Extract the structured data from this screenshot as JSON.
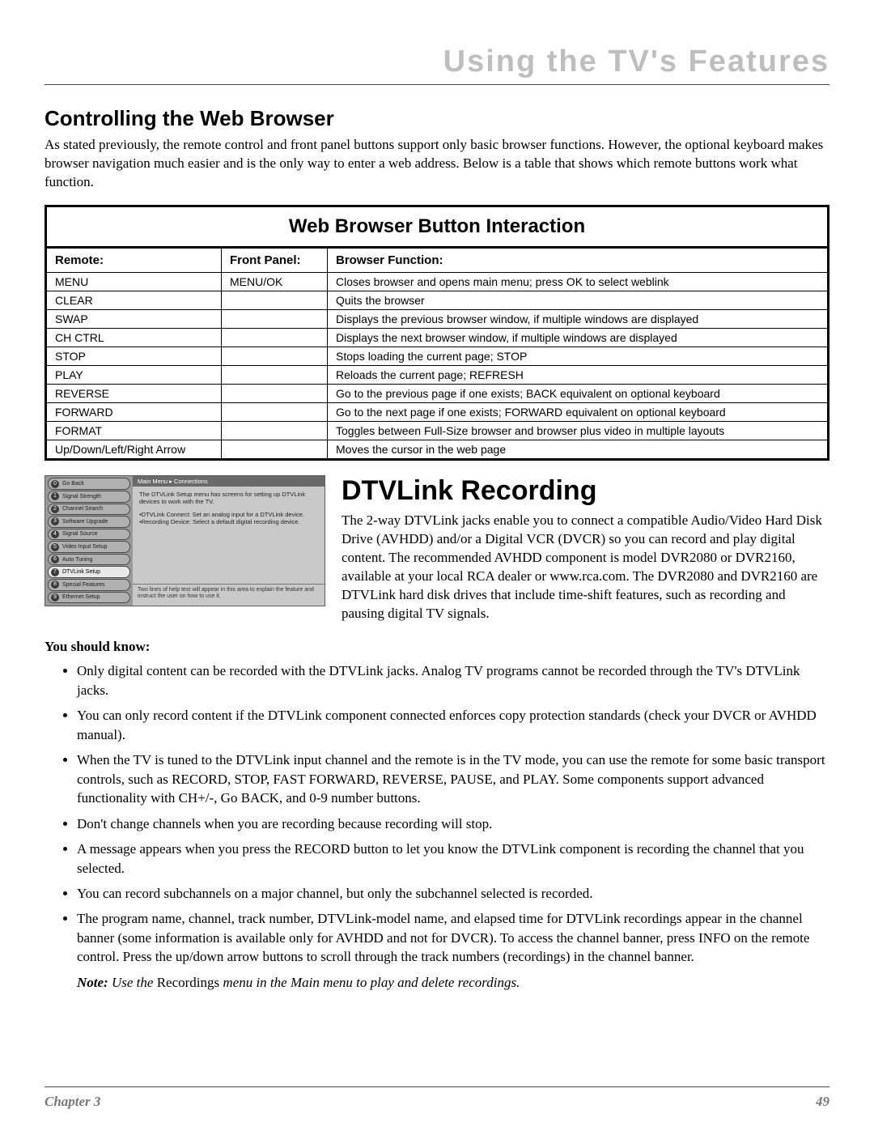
{
  "header": {
    "title": "Using the TV's Features"
  },
  "section1": {
    "heading": "Controlling the Web Browser",
    "paragraph": "As stated previously, the remote control and front panel buttons support only basic browser functions. However, the optional keyboard makes browser navigation much easier and is the only way to enter a web address. Below is a table that shows which remote buttons work what function."
  },
  "table": {
    "title": "Web Browser Button Interaction",
    "headers": {
      "remote": "Remote:",
      "front": "Front Panel:",
      "func": "Browser Function:"
    },
    "rows": [
      {
        "remote": "MENU",
        "front": "MENU/OK",
        "func": "Closes browser and opens main menu; press OK to select weblink"
      },
      {
        "remote": "CLEAR",
        "front": "",
        "func": "Quits the browser"
      },
      {
        "remote": "SWAP",
        "front": "",
        "func": "Displays the previous browser window, if multiple windows are displayed"
      },
      {
        "remote": "CH CTRL",
        "front": "",
        "func": "Displays the next browser window, if multiple windows are displayed"
      },
      {
        "remote": "STOP",
        "front": "",
        "func": "Stops loading the current page; STOP"
      },
      {
        "remote": "PLAY",
        "front": "",
        "func": "Reloads the current page; REFRESH"
      },
      {
        "remote": "REVERSE",
        "front": "",
        "func": "Go to the previous page if one exists; BACK equivalent on optional keyboard"
      },
      {
        "remote": "FORWARD",
        "front": "",
        "func": "Go to the next page if one exists; FORWARD equivalent on optional keyboard"
      },
      {
        "remote": "FORMAT",
        "front": "",
        "func": "Toggles between Full-Size browser and browser plus video in multiple layouts"
      },
      {
        "remote": "Up/Down/Left/Right Arrow",
        "front": "",
        "func": "Moves the cursor in the web page"
      }
    ]
  },
  "menushot": {
    "crumb": "Main Menu ▸ Connections",
    "items": [
      {
        "n": "0",
        "label": "Go Back"
      },
      {
        "n": "1",
        "label": "Signal Strength"
      },
      {
        "n": "2",
        "label": "Channel Search"
      },
      {
        "n": "3",
        "label": "Software Upgrade"
      },
      {
        "n": "4",
        "label": "Signal Source"
      },
      {
        "n": "5",
        "label": "Video Input Setup"
      },
      {
        "n": "6",
        "label": "Auto Tuning"
      },
      {
        "n": "7",
        "label": "DTVLink Setup"
      },
      {
        "n": "8",
        "label": "Special Features"
      },
      {
        "n": "9",
        "label": "Ethernet Setup"
      }
    ],
    "selected_index": 7,
    "desc_line1": "The DTVLink Setup menu has screens for setting up DTVLink devices to work with the TV.",
    "desc_bullet1": "•DTVLink Connect: Set an analog input for a DTVLink device.",
    "desc_bullet2": "•Recording Device: Select a default digital recording device.",
    "help": "Two lines of help text will appear in this area to explain the feature and instruct the user on how to use it."
  },
  "section2": {
    "heading": "DTVLink Recording",
    "paragraph": "The 2-way DTVLink jacks enable you to connect a compatible Audio/Video Hard Disk Drive (AVHDD) and/or a Digital VCR (DVCR) so you can record and play digital content. The recommended AVHDD component is model DVR2080 or DVR2160, available at your local RCA dealer or www.rca.com. The DVR2080 and DVR2160 are DTVLink hard disk drives that include time-shift features, such as recording and pausing digital TV signals."
  },
  "you_should_know": {
    "label": "You should know:",
    "bullets": [
      "Only digital content can be recorded with the DTVLink jacks. Analog TV programs cannot be recorded through the TV's DTVLink jacks.",
      "You can only record content if the DTVLink component connected enforces copy protection standards (check your DVCR or AVHDD manual).",
      "When the TV is tuned to the DTVLink input channel and the remote is in the TV mode, you can use the remote for some basic transport controls, such as RECORD, STOP, FAST FORWARD, REVERSE, PAUSE, and PLAY. Some components support advanced functionality with CH+/-, Go BACK, and 0-9 number buttons.",
      "Don't change channels when you are recording because recording will stop.",
      "A message appears when you press the RECORD button to let you know the DTVLink component is recording the channel that you selected.",
      "You can record subchannels on a major channel, but only the subchannel selected is recorded.",
      "The program name, channel, track number, DTVLink-model name, and elapsed time for DTVLink recordings appear in the channel banner (some information is available only for AVHDD and not for DVCR). To access the channel banner, press INFO on the remote control. Press the up/down arrow buttons to scroll through the track numbers (recordings) in the channel banner."
    ],
    "note_prefix": "Note:",
    "note_rest_a": " Use the ",
    "note_nonitalic": "Recordings",
    "note_rest_b": " menu in the Main menu to play and delete recordings."
  },
  "footer": {
    "chapter": "Chapter 3",
    "page": "49"
  }
}
